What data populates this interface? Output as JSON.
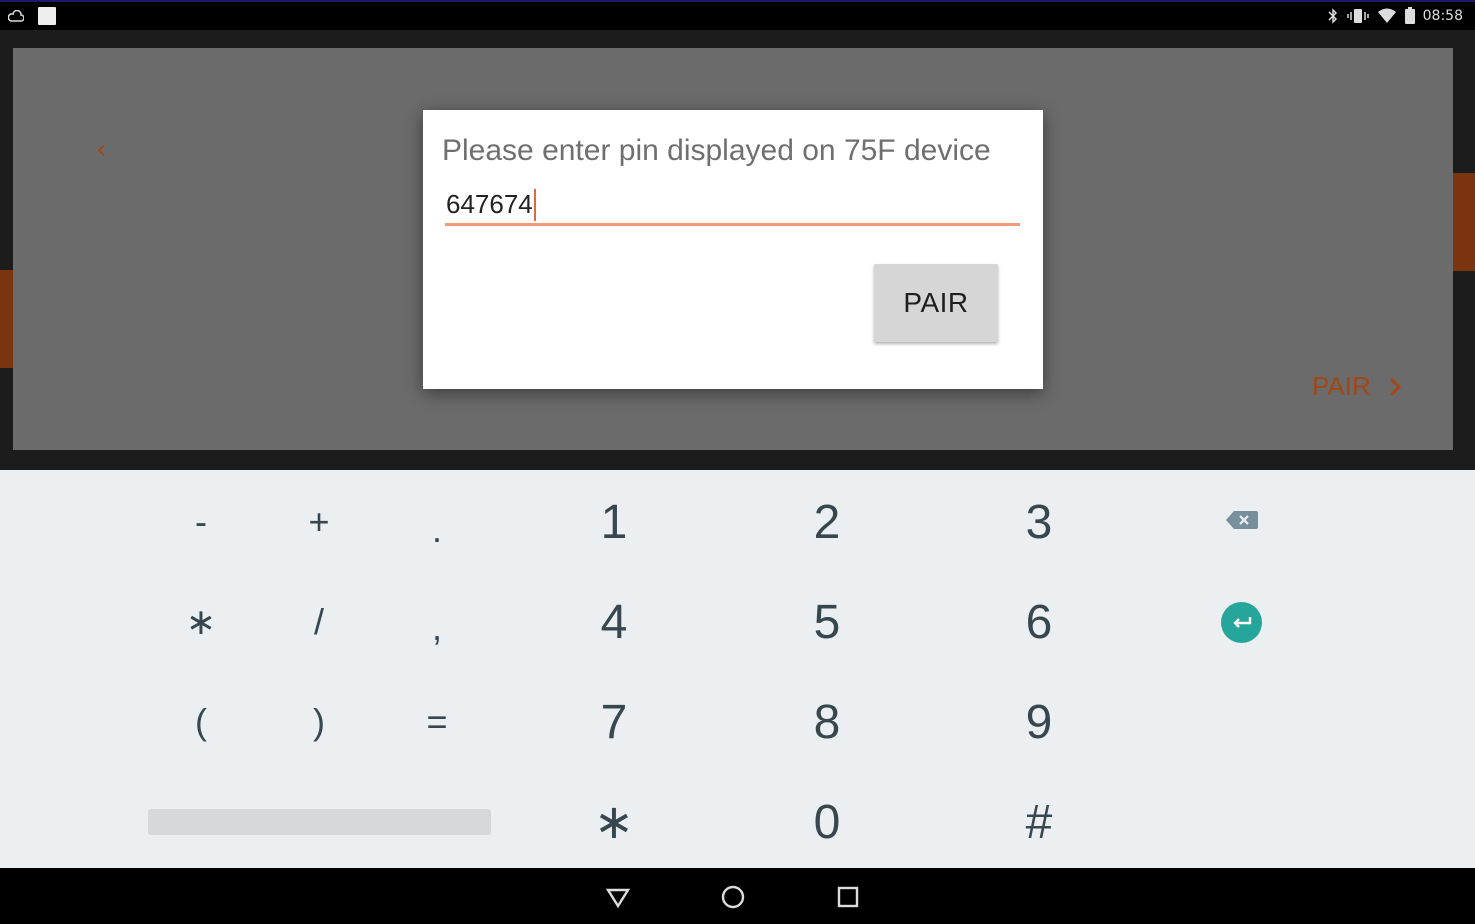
{
  "status_bar": {
    "time": "08:58",
    "icons": [
      "cloud-icon",
      "notification-square-icon",
      "bluetooth-icon",
      "vibrate-icon",
      "wifi-icon",
      "battery-icon"
    ]
  },
  "background": {
    "pair_label": "PAIR",
    "accent_color": "#a24715"
  },
  "dialog": {
    "title": "Please enter pin displayed on 75F device",
    "pin_value": "647674",
    "pair_button": "PAIR",
    "input_underline_color": "#f2997a"
  },
  "keyboard": {
    "row1_symbols": [
      "-",
      "+",
      "."
    ],
    "row2_symbols": [
      "∗",
      "/",
      ","
    ],
    "row3_symbols": [
      "(",
      ")",
      "="
    ],
    "row1_digits": [
      "1",
      "2",
      "3"
    ],
    "row2_digits": [
      "4",
      "5",
      "6"
    ],
    "row3_digits": [
      "7",
      "8",
      "9"
    ],
    "row4_digits": [
      "∗",
      "0",
      "#"
    ],
    "enter_color": "#26a69a"
  }
}
